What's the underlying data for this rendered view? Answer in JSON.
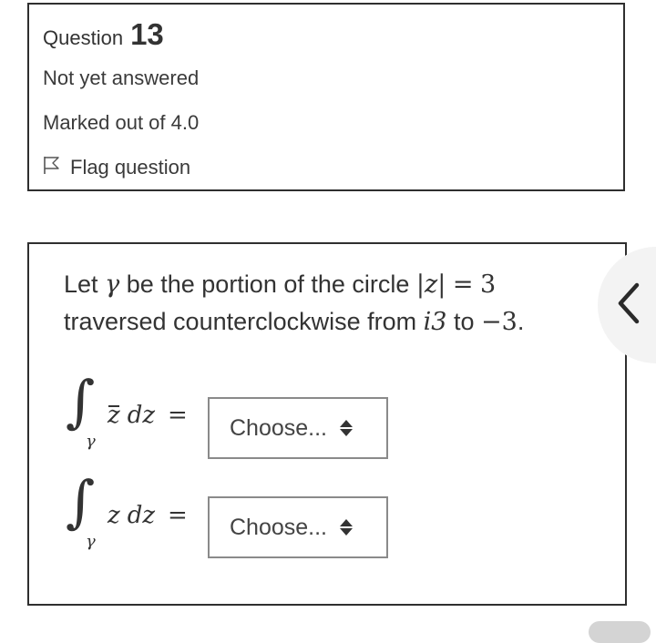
{
  "info": {
    "question_label": "Question",
    "question_number": "13",
    "state": "Not yet answered",
    "grade": "Marked out of 4.0",
    "flag_label": "Flag question",
    "flag_icon": "flag-outline-icon"
  },
  "question": {
    "text_1": "Let",
    "gamma": "γ",
    "text_2": "be the portion of the circle",
    "abs_z": "|z|",
    "equals": "=",
    "three": "3",
    "text_3": "traversed counterclockwise from",
    "from_val": "i3",
    "text_4": "to",
    "to_val": "−3",
    "period": "."
  },
  "parts": [
    {
      "integral_sign": "∫",
      "subscript": "γ",
      "integrand_var": "z",
      "differential": "dz",
      "equals": "=",
      "select_value": "Choose..."
    },
    {
      "integral_sign": "∫",
      "subscript": "γ",
      "integrand_var": "z",
      "differential": "dz",
      "equals": "=",
      "select_value": "Choose..."
    }
  ],
  "drawer": {
    "icon": "chevron-left-icon"
  },
  "colors": {
    "border": "#2f2f2f",
    "select_border": "#8a8a8a",
    "drawer_bg": "#f3f3f3"
  }
}
